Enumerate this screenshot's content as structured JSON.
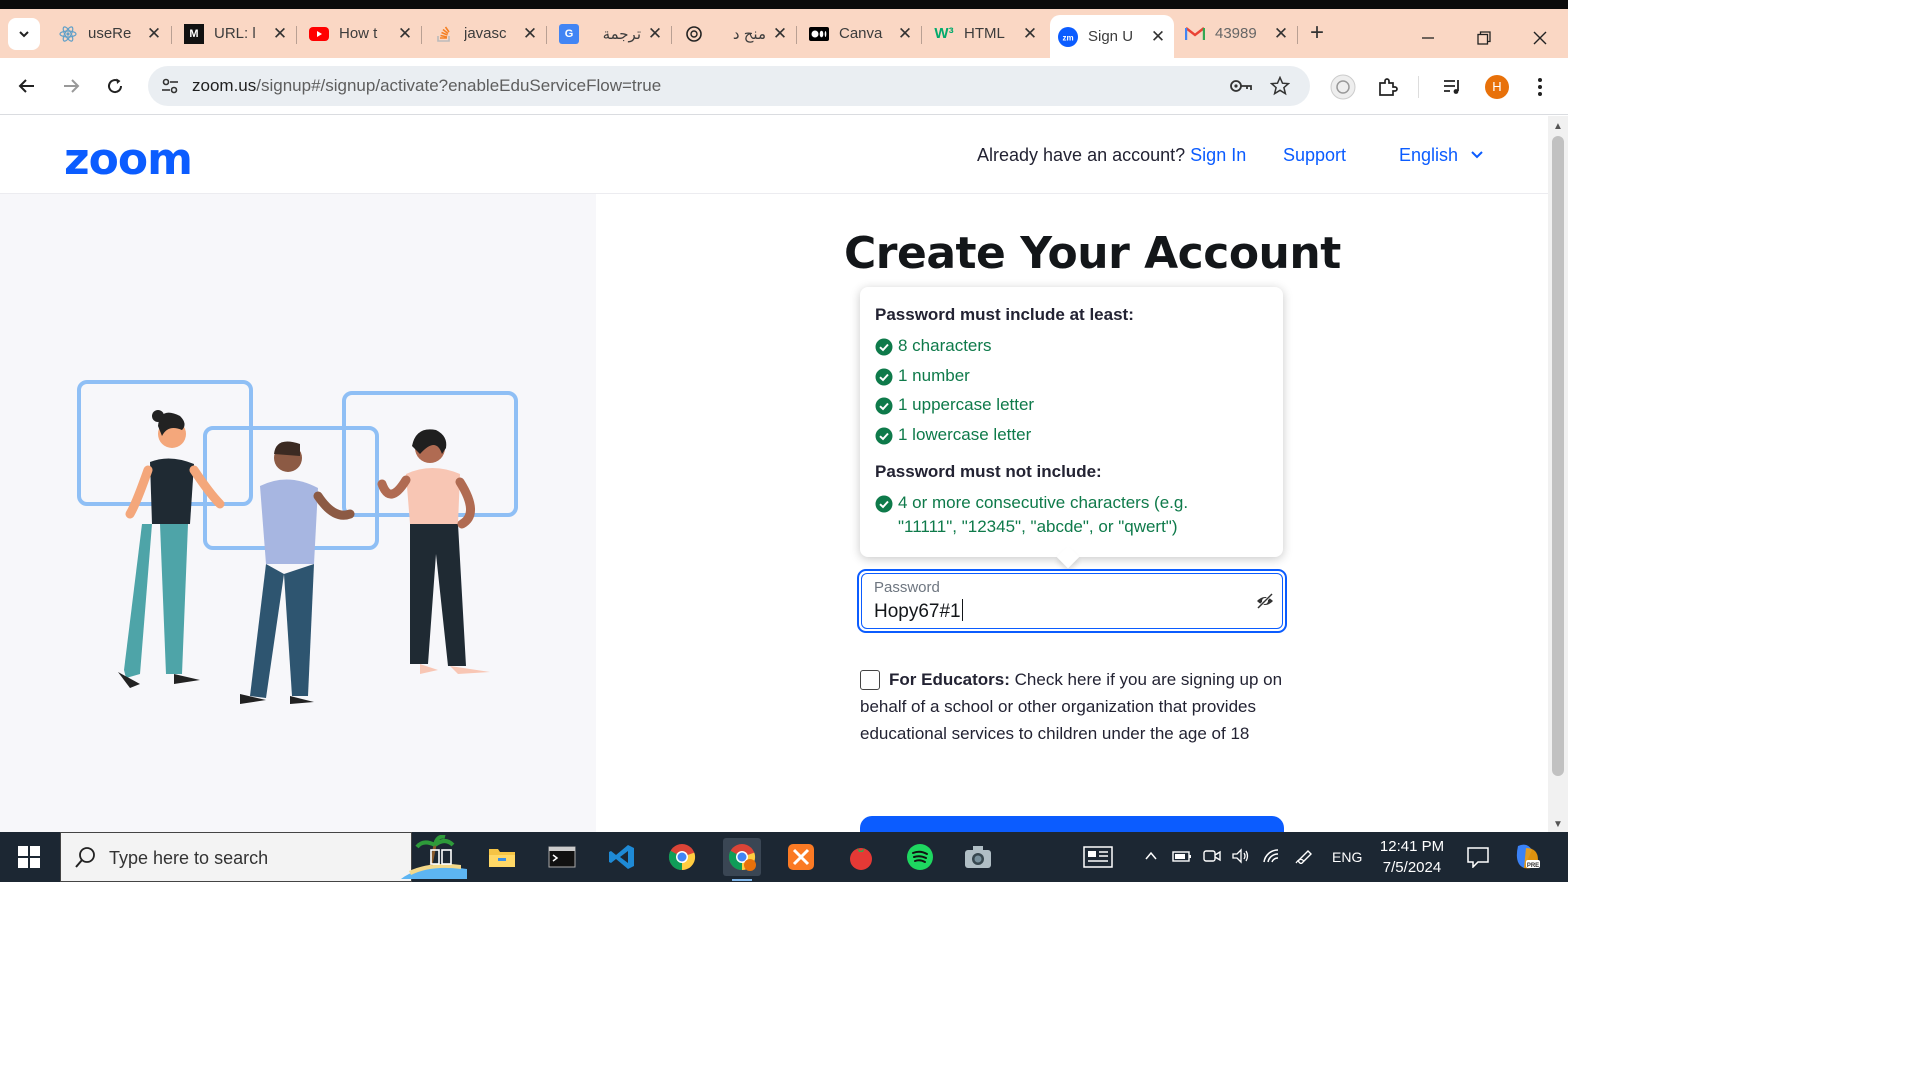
{
  "browser": {
    "tabs": [
      {
        "title": "useRe",
        "icon": "react-icon",
        "active": false
      },
      {
        "title": "URL: l",
        "icon": "m-logo-icon",
        "active": false
      },
      {
        "title": "How t",
        "icon": "youtube-icon",
        "active": false
      },
      {
        "title": "javasc",
        "icon": "stackoverflow-icon",
        "active": false
      },
      {
        "title": "ترجمة",
        "icon": "google-translate-icon",
        "active": false
      },
      {
        "title": "منح د",
        "icon": "chatgpt-icon",
        "active": false
      },
      {
        "title": "Canva",
        "icon": "medium-icon",
        "active": false
      },
      {
        "title": "HTML",
        "icon": "w3schools-icon",
        "active": false
      },
      {
        "title": "Sign U",
        "icon": "zoom-icon",
        "active": true
      },
      {
        "title": "43989",
        "icon": "gmail-icon",
        "active": false
      }
    ],
    "url_host": "zoom.us",
    "url_path": "/signup#/signup/activate?enableEduServiceFlow=true",
    "profile_initial": "H"
  },
  "site": {
    "logo": "zoom",
    "already_text": "Already have an account?",
    "sign_in": "Sign In",
    "support": "Support",
    "language": "English"
  },
  "form": {
    "heading": "Create Your Account",
    "tooltip_heading_include": "Password must include at least:",
    "requirements": [
      "8 characters",
      "1 number",
      "1 uppercase letter",
      "1 lowercase letter"
    ],
    "tooltip_heading_exclude": "Password must not include:",
    "exclusion": "4 or more consecutive characters (e.g. \"11111\", \"12345\", \"abcde\", or \"qwert\")",
    "password_label": "Password",
    "password_value": "Hopy67#1",
    "educator_bold": "For Educators:",
    "educator_text": " Check here if you are signing up on behalf of a school or other organization that provides educational services to children under the age of 18"
  },
  "taskbar": {
    "search_placeholder": "Type here to search",
    "language": "ENG",
    "time": "12:41 PM",
    "date": "7/5/2024"
  },
  "colors": {
    "zoom_blue": "#0b5cff",
    "success_green": "#0e7a4a",
    "tabstrip": "#fad7c4"
  }
}
